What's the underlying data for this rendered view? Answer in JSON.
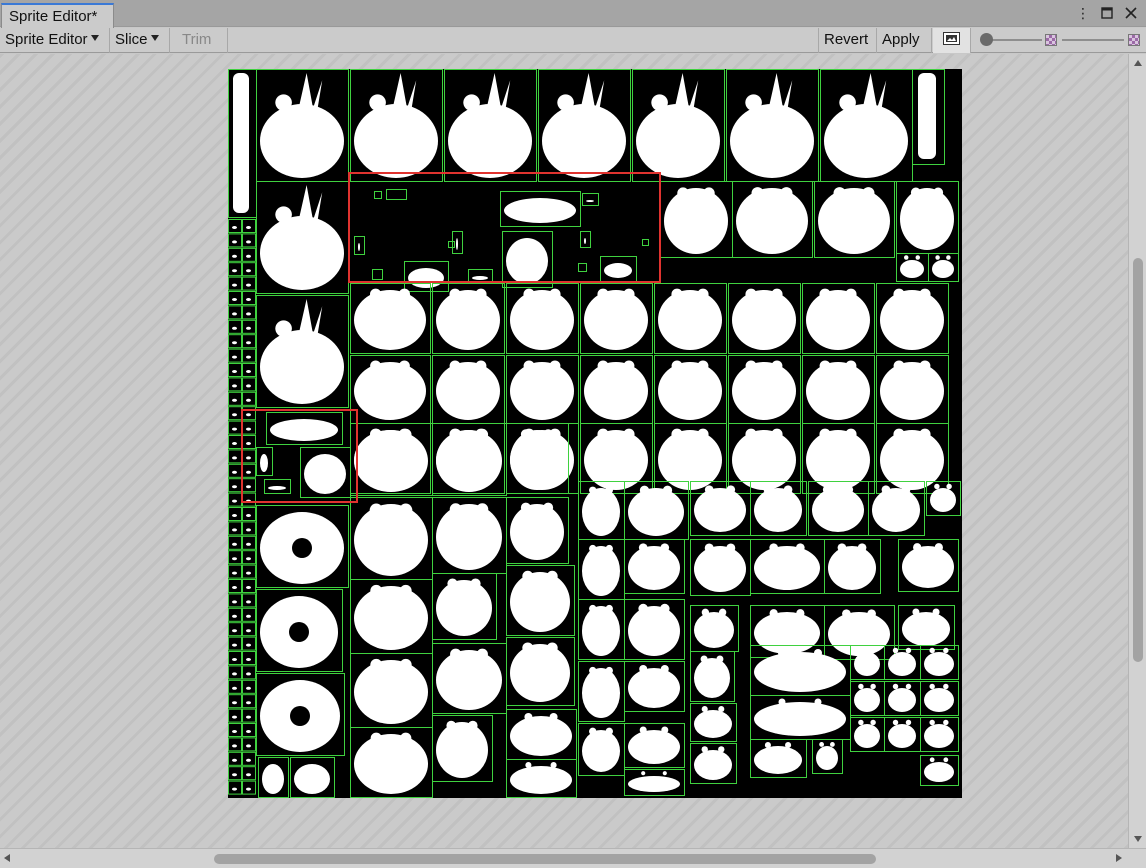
{
  "window": {
    "tab_title": "Sprite Editor*"
  },
  "toolbar": {
    "mode_label": "Sprite Editor",
    "slice_label": "Slice",
    "trim_label": "Trim",
    "revert_label": "Revert",
    "apply_label": "Apply"
  },
  "icons": {
    "more": "more-vert-icon",
    "maximize": "maximize-icon",
    "close": "close-icon",
    "preview": "image-preview-icon",
    "zoom_small": "checker-small-icon",
    "zoom_large": "checker-large-icon"
  },
  "colors": {
    "sprite_outline": "#3fd13f",
    "selection": "#e0332f",
    "sheet_background": "#000000",
    "sprite_fill": "#ffffff"
  },
  "sliders": {
    "alpha_level": 0.0,
    "zoom_level": 1.0
  }
}
